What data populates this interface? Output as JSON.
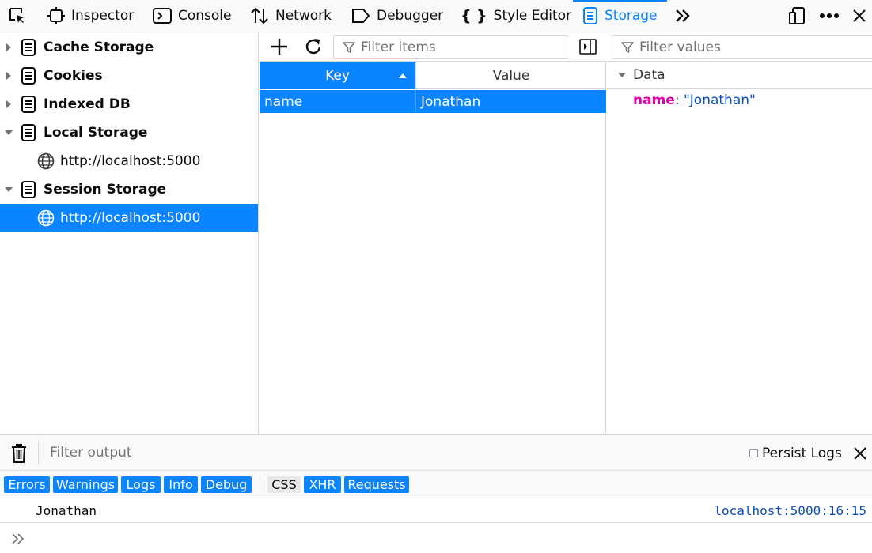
{
  "toolbar": {
    "tabs": [
      {
        "label": "Inspector",
        "icon": "inspector-icon"
      },
      {
        "label": "Console",
        "icon": "console-icon"
      },
      {
        "label": "Network",
        "icon": "network-icon"
      },
      {
        "label": "Debugger",
        "icon": "debugger-icon"
      },
      {
        "label": "Style Editor",
        "icon": "style-editor-icon"
      },
      {
        "label": "Storage",
        "icon": "storage-icon",
        "active": true
      }
    ]
  },
  "sidebar": {
    "items": [
      {
        "label": "Cache Storage",
        "expanded": false
      },
      {
        "label": "Cookies",
        "expanded": false
      },
      {
        "label": "Indexed DB",
        "expanded": false
      },
      {
        "label": "Local Storage",
        "expanded": true
      },
      {
        "label": "http://localhost:5000"
      },
      {
        "label": "Session Storage",
        "expanded": true
      },
      {
        "label": "http://localhost:5000",
        "selected": true
      }
    ]
  },
  "table": {
    "filter_placeholder": "Filter items",
    "columns": [
      "Key",
      "Value"
    ],
    "rows": [
      {
        "key": "name",
        "value": "Jonathan"
      }
    ]
  },
  "detail": {
    "filter_placeholder": "Filter values",
    "section": "Data",
    "prop_name": "name",
    "prop_sep": ":",
    "prop_value": "\"Jonathan\""
  },
  "console": {
    "filter_placeholder": "Filter output",
    "persist_label": "Persist Logs",
    "filters": [
      "Errors",
      "Warnings",
      "Logs",
      "Info",
      "Debug",
      "CSS",
      "XHR",
      "Requests"
    ],
    "message": "Jonathan",
    "location": "localhost:5000:16:15"
  },
  "colors": {
    "accent": "#0a84ff",
    "prop_name": "#dd00a9",
    "prop_value": "#0a4ebb"
  }
}
